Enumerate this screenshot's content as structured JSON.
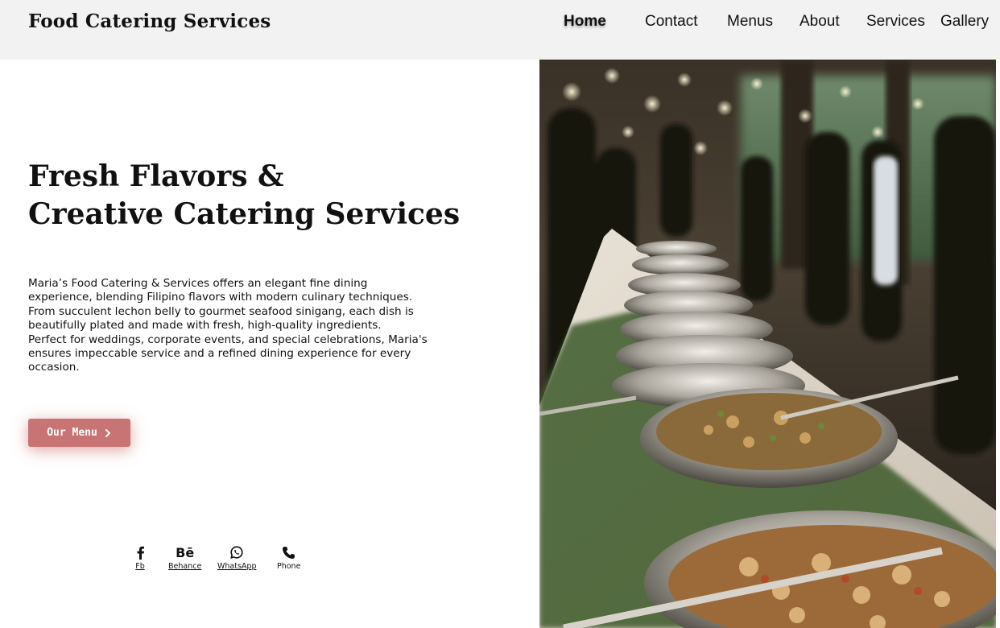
{
  "header": {
    "brand": "Food Catering Services",
    "nav": [
      {
        "label": "Home",
        "active": true
      },
      {
        "label": "Contact"
      },
      {
        "label": "Menus"
      },
      {
        "label": "About"
      },
      {
        "label": "Services"
      },
      {
        "label": "Gallery"
      }
    ]
  },
  "hero": {
    "title_line1": "Fresh Flavors &",
    "title_line2": "Creative Catering Services",
    "description_p1": "Maria’s Food Catering & Services offers an elegant fine dining experience, blending Filipino flavors with modern culinary techniques. From succulent lechon belly to gourmet seafood sinigang, each dish is beautifully plated and made with fresh, high-quality ingredients.",
    "description_p2": "Perfect for weddings, corporate events, and special celebrations, Maria's ensures impeccable service and a refined dining experience for every occasion.",
    "cta_label": "Our Menu",
    "cta_icon": "chevron-right-icon"
  },
  "social": [
    {
      "label": "Fb",
      "icon": "facebook-icon"
    },
    {
      "label": "Behance",
      "icon": "behance-icon"
    },
    {
      "label": "WhatsApp",
      "icon": "whatsapp-icon"
    },
    {
      "label": "Phone",
      "icon": "phone-icon"
    }
  ],
  "colors": {
    "header_bg": "#f2f2f2",
    "accent": "#c87474",
    "text": "#111111"
  }
}
